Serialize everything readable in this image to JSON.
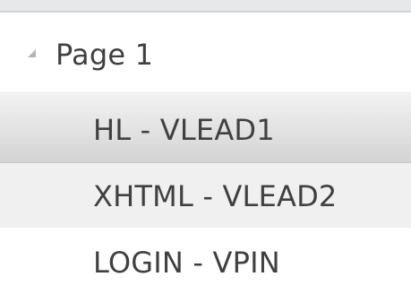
{
  "tree": {
    "parent": {
      "label": "Page 1",
      "expanded": true,
      "icon": "expanded-triangle-icon"
    },
    "children": [
      {
        "label": "HL - VLEAD1",
        "state": "selected"
      },
      {
        "label": "XHTML - VLEAD2",
        "state": "hover"
      },
      {
        "label": "LOGIN - VPIN",
        "state": "normal"
      }
    ]
  },
  "colors": {
    "text": "#404040",
    "selected_background": "#dcdcdc",
    "hover_background": "#f0f0f0",
    "expander": "#b3b3b3"
  }
}
